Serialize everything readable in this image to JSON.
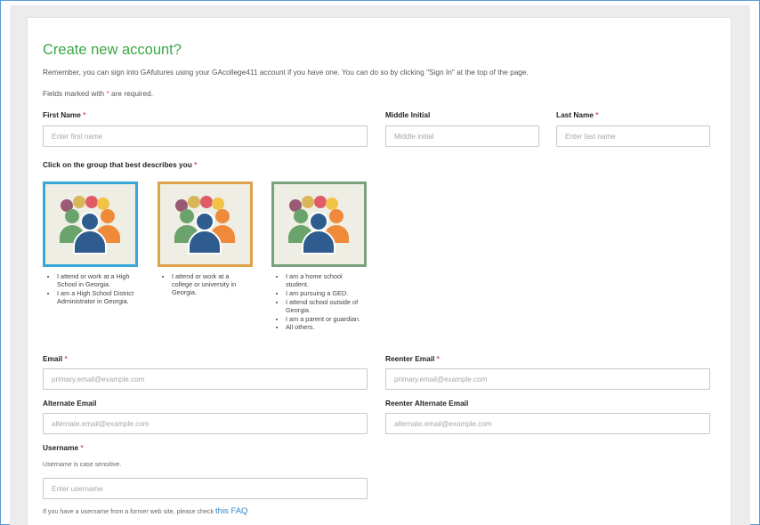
{
  "form": {
    "title": "Create new account?",
    "intro": "Remember, you can sign into GAfutures using your GAcollege411 account if you have one. You can do so by clicking \"Sign In\" at the top of the page.",
    "required_note_prefix": "Fields marked with",
    "required_note_star": "*",
    "required_note_suffix": "are required.",
    "required_star": "*"
  },
  "name": {
    "first_label": "First Name",
    "first_placeholder": "Enter first name",
    "middle_label": "Middle Initial",
    "middle_placeholder": "Middle initial",
    "last_label": "Last Name",
    "last_placeholder": "Enter last name"
  },
  "group": {
    "label": "Click on the group that best describes you",
    "options": [
      {
        "border_color": "#3ba6d8",
        "bullets": [
          "I attend or work at a High School in Georgia.",
          "I am a High School District Administrator in Georgia."
        ]
      },
      {
        "border_color": "#dda24a",
        "bullets": [
          "I attend or work at a college or university in Georgia."
        ]
      },
      {
        "border_color": "#7aa17e",
        "bullets": [
          "I am a home school student.",
          "I am pursuing a GED.",
          "I attend school outside of Georgia.",
          "I am a parent or guardian.",
          "All others."
        ]
      }
    ]
  },
  "email": {
    "label": "Email",
    "placeholder": "primary.email@example.com",
    "reenter_label": "Reenter Email",
    "reenter_placeholder": "primary.email@example.com"
  },
  "alt_email": {
    "label": "Alternate Email",
    "placeholder": "alternate.email@example.com",
    "reenter_label": "Reenter Alternate Email",
    "reenter_placeholder": "alternate.email@example.com"
  },
  "username": {
    "label": "Username",
    "help": "Username is case sensitive.",
    "placeholder": "Enter username",
    "faq_prefix": "If you have a username from a former web site, please check",
    "faq_link": "this FAQ"
  },
  "colors": {
    "accent_green": "#3aa847",
    "required_red": "#d9534f",
    "link_blue": "#2f85c8"
  }
}
